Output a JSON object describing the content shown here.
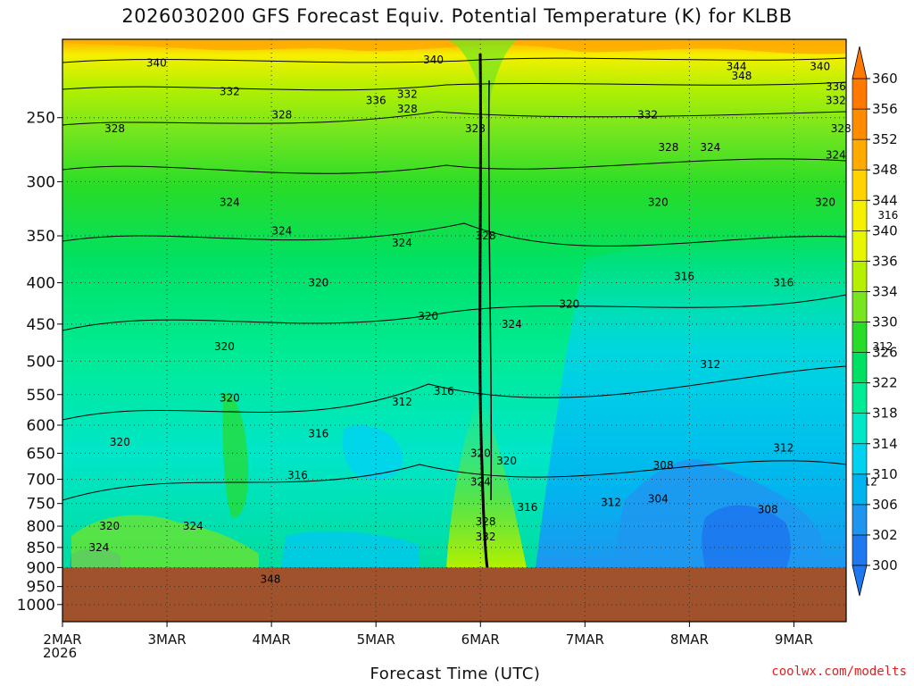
{
  "chart_data": {
    "type": "heatmap",
    "title": "2026030200 GFS Forecast Equiv. Potential Temperature (K) for KLBB",
    "xlabel": "Forecast Time (UTC)",
    "ylabel": "",
    "year_label": "2026",
    "credit": "coolwx.com/modelts",
    "x_ticks": [
      "2MAR",
      "3MAR",
      "4MAR",
      "5MAR",
      "6MAR",
      "7MAR",
      "8MAR",
      "9MAR"
    ],
    "x_range_days": [
      0,
      7.5
    ],
    "y_ticks": [
      250,
      300,
      350,
      400,
      450,
      500,
      550,
      600,
      650,
      700,
      750,
      800,
      850,
      900,
      950,
      1000
    ],
    "y_range_hpa": [
      200,
      1050
    ],
    "y_scale": "log-pressure",
    "surface_pressure_hpa": 900,
    "colorbar": {
      "levels": [
        300,
        302,
        306,
        310,
        314,
        318,
        322,
        326,
        330,
        334,
        336,
        340,
        344,
        348,
        352,
        356,
        360
      ],
      "colors": [
        "#1e78f0",
        "#1e96f0",
        "#00b4f0",
        "#00d2f0",
        "#00e6c8",
        "#00eb96",
        "#00e164",
        "#28dc28",
        "#78e61e",
        "#b4f000",
        "#e6f500",
        "#f5f000",
        "#ffd200",
        "#ffaa00",
        "#ff8c00",
        "#ff7800"
      ],
      "ground_color": "#a0522d"
    },
    "contour_labels": [
      {
        "t": 1.99,
        "p": 930,
        "v": "348"
      },
      {
        "t": 0.9,
        "p": 214,
        "v": "340"
      },
      {
        "t": 3.55,
        "p": 212,
        "v": "340"
      },
      {
        "t": 6.45,
        "p": 216,
        "v": "344"
      },
      {
        "t": 6.5,
        "p": 222,
        "v": "348"
      },
      {
        "t": 7.25,
        "p": 216,
        "v": "340"
      },
      {
        "t": 1.6,
        "p": 232,
        "v": "332"
      },
      {
        "t": 3.3,
        "p": 234,
        "v": "332"
      },
      {
        "t": 3.0,
        "p": 238,
        "v": "336"
      },
      {
        "t": 5.6,
        "p": 248,
        "v": "332"
      },
      {
        "t": 7.4,
        "p": 229,
        "v": "336"
      },
      {
        "t": 7.4,
        "p": 238,
        "v": "332"
      },
      {
        "t": 0.5,
        "p": 258,
        "v": "328"
      },
      {
        "t": 2.1,
        "p": 248,
        "v": "328"
      },
      {
        "t": 3.3,
        "p": 244,
        "v": "328"
      },
      {
        "t": 3.95,
        "p": 258,
        "v": "328"
      },
      {
        "t": 5.8,
        "p": 272,
        "v": "328"
      },
      {
        "t": 6.2,
        "p": 272,
        "v": "324"
      },
      {
        "t": 7.45,
        "p": 258,
        "v": "328"
      },
      {
        "t": 7.4,
        "p": 278,
        "v": "324"
      },
      {
        "t": 1.6,
        "p": 318,
        "v": "324"
      },
      {
        "t": 2.1,
        "p": 345,
        "v": "324"
      },
      {
        "t": 3.25,
        "p": 357,
        "v": "324"
      },
      {
        "t": 4.05,
        "p": 350,
        "v": "328"
      },
      {
        "t": 5.7,
        "p": 318,
        "v": "320"
      },
      {
        "t": 7.3,
        "p": 318,
        "v": "320"
      },
      {
        "t": 7.9,
        "p": 330,
        "v": "316"
      },
      {
        "t": 2.45,
        "p": 400,
        "v": "320"
      },
      {
        "t": 3.5,
        "p": 440,
        "v": "320"
      },
      {
        "t": 4.3,
        "p": 450,
        "v": "324"
      },
      {
        "t": 4.85,
        "p": 425,
        "v": "320"
      },
      {
        "t": 5.95,
        "p": 393,
        "v": "316"
      },
      {
        "t": 6.9,
        "p": 400,
        "v": "316"
      },
      {
        "t": 1.55,
        "p": 480,
        "v": "320"
      },
      {
        "t": 7.85,
        "p": 480,
        "v": "312"
      },
      {
        "t": 6.2,
        "p": 505,
        "v": "312"
      },
      {
        "t": 1.6,
        "p": 555,
        "v": "320"
      },
      {
        "t": 3.25,
        "p": 562,
        "v": "312"
      },
      {
        "t": 3.65,
        "p": 545,
        "v": "316"
      },
      {
        "t": 0.55,
        "p": 630,
        "v": "320"
      },
      {
        "t": 2.45,
        "p": 615,
        "v": "316"
      },
      {
        "t": 2.25,
        "p": 692,
        "v": "316"
      },
      {
        "t": 4.0,
        "p": 650,
        "v": "320"
      },
      {
        "t": 4.25,
        "p": 664,
        "v": "320"
      },
      {
        "t": 4.0,
        "p": 705,
        "v": "324"
      },
      {
        "t": 5.75,
        "p": 673,
        "v": "308"
      },
      {
        "t": 6.9,
        "p": 640,
        "v": "312"
      },
      {
        "t": 7.7,
        "p": 705,
        "v": "312"
      },
      {
        "t": 4.45,
        "p": 758,
        "v": "316"
      },
      {
        "t": 5.25,
        "p": 748,
        "v": "312"
      },
      {
        "t": 5.7,
        "p": 740,
        "v": "304"
      },
      {
        "t": 6.75,
        "p": 763,
        "v": "308"
      },
      {
        "t": 4.05,
        "p": 790,
        "v": "328"
      },
      {
        "t": 4.05,
        "p": 825,
        "v": "332"
      },
      {
        "t": 0.45,
        "p": 800,
        "v": "320"
      },
      {
        "t": 1.25,
        "p": 800,
        "v": "324"
      },
      {
        "t": 0.35,
        "p": 850,
        "v": "324"
      }
    ]
  }
}
